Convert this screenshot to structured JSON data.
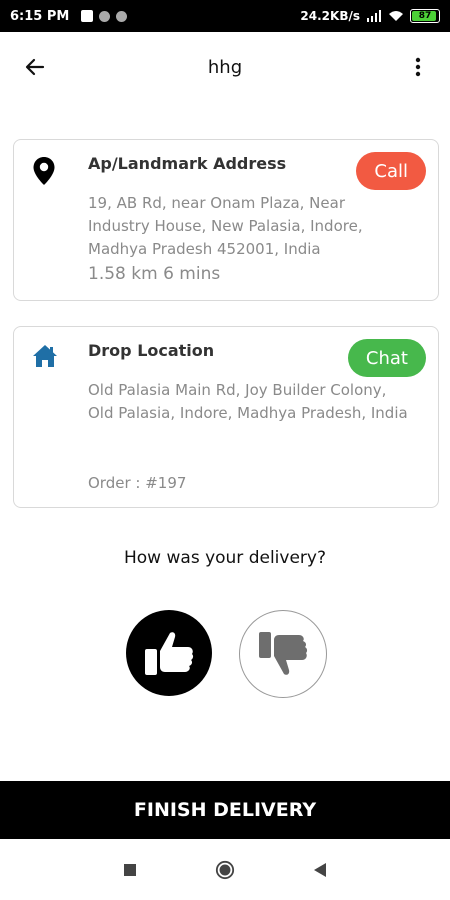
{
  "status": {
    "time": "6:15 PM",
    "network_speed": "24.2KB/s",
    "battery": "87"
  },
  "header": {
    "title": "hhg"
  },
  "pickup": {
    "title": "Ap/Landmark Address",
    "address": "19, AB Rd, near Onam Plaza, Near Industry House, New Palasia, Indore, Madhya Pradesh 452001, India",
    "distance_time": "1.58 km  6 mins",
    "call_label": "Call"
  },
  "drop": {
    "title": "Drop Location",
    "address": "Old Palasia Main Rd, Joy Builder Colony, Old Palasia, Indore, Madhya Pradesh, India",
    "order": "Order : #197",
    "chat_label": "Chat"
  },
  "feedback": {
    "question": "How was your delivery?",
    "selected": "thumbs-up"
  },
  "actions": {
    "finish_label": "FINISH DELIVERY"
  },
  "icons": {
    "pickup": "location-pin-icon",
    "drop": "home-icon",
    "back": "arrow-left-icon",
    "more": "more-vertical-icon"
  }
}
